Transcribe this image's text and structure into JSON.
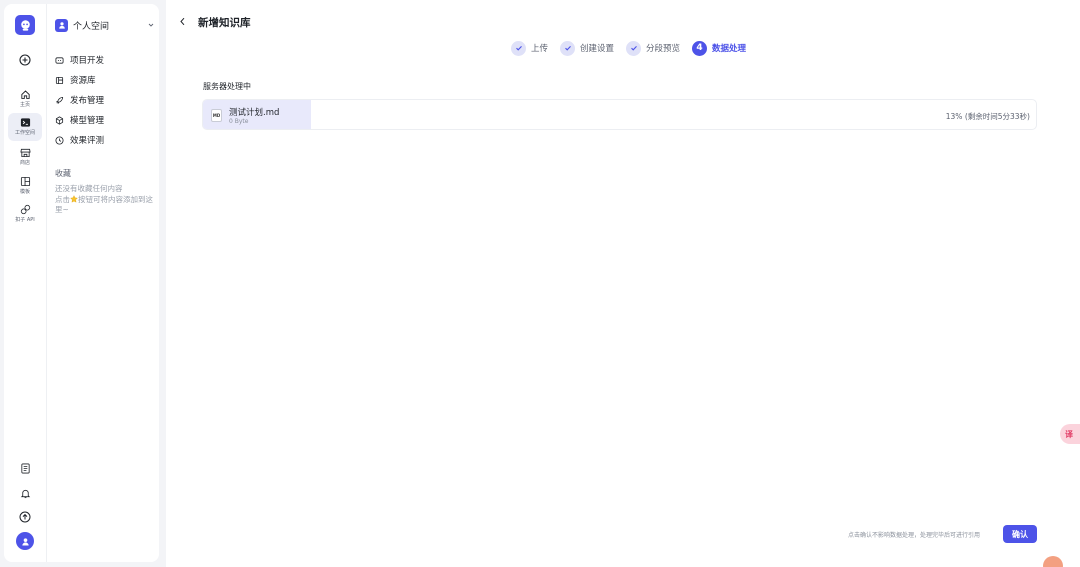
{
  "rail": {
    "items": [
      {
        "label": "",
        "icon": "add-icon"
      },
      {
        "label": "主页",
        "icon": "home-icon"
      },
      {
        "label": "工作空间",
        "icon": "terminal-icon"
      },
      {
        "label": "商店",
        "icon": "store-icon"
      },
      {
        "label": "模板",
        "icon": "template-icon"
      },
      {
        "label": "扣子 API",
        "icon": "link-icon"
      }
    ],
    "active_index": 2
  },
  "sidebar": {
    "space_name": "个人空间",
    "nav": [
      {
        "label": "项目开发",
        "icon": "project-icon"
      },
      {
        "label": "资源库",
        "icon": "library-icon"
      },
      {
        "label": "发布管理",
        "icon": "rocket-icon"
      },
      {
        "label": "模型管理",
        "icon": "model-icon"
      },
      {
        "label": "效果评测",
        "icon": "evaluate-icon"
      }
    ],
    "favorites_title": "收藏",
    "favorites_hint_1": "还没有收藏任何内容",
    "favorites_hint_2_prefix": "点击",
    "favorites_hint_2_suffix": "按钮可将内容添加到这里~"
  },
  "page": {
    "title": "新增知识库",
    "steps": [
      {
        "label": "上传",
        "state": "done"
      },
      {
        "label": "创建设置",
        "state": "done"
      },
      {
        "label": "分段预览",
        "state": "done"
      },
      {
        "label": "数据处理",
        "state": "current",
        "number": "4"
      }
    ],
    "section_label": "服务器处理中",
    "file": {
      "icon_text": "MD",
      "name": "测试计划.md",
      "size": "0 Byte",
      "status": "13% (剩余时间5分33秒)",
      "progress_percent": 13
    },
    "footer_hint": "点击确认不影响数据处理，处理完毕后可进行引用",
    "confirm_label": "确认"
  },
  "floating": {
    "translate_label": "译"
  },
  "colors": {
    "accent": "#4d53e8",
    "accent_light": "#dfe1f8",
    "progress_fill": "#e8e9fb"
  }
}
